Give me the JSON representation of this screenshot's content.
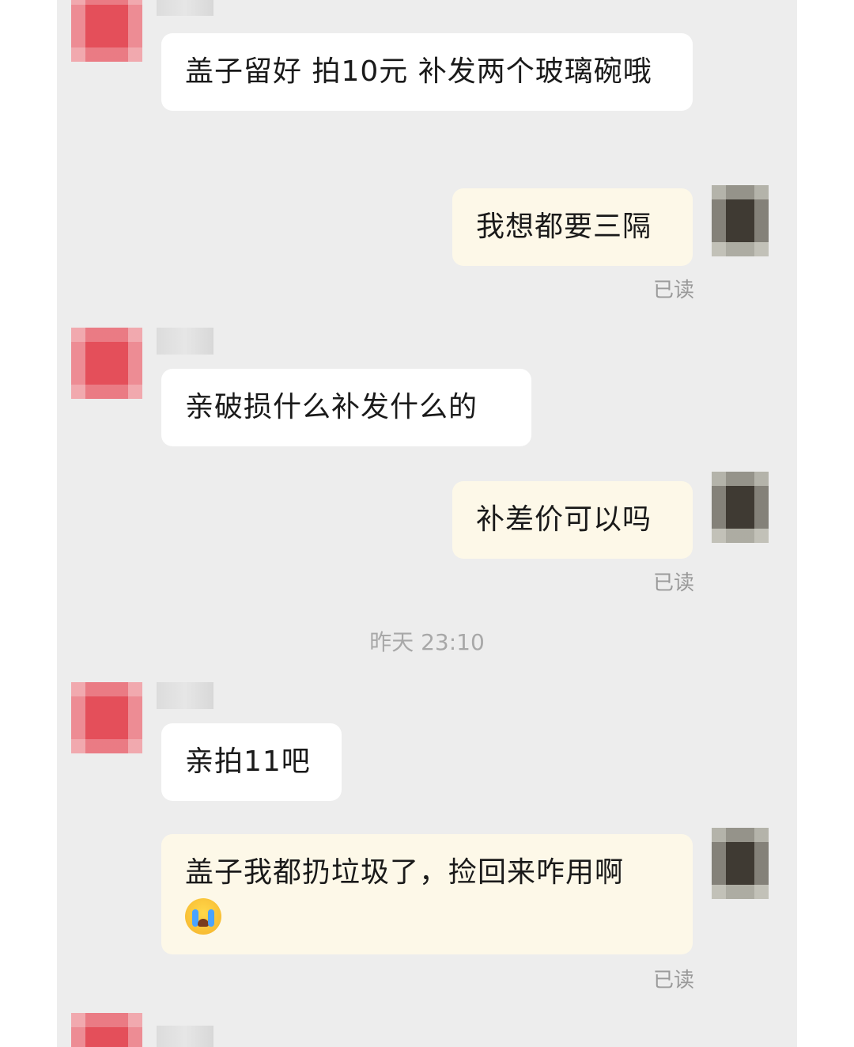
{
  "messages": [
    {
      "sender": "merchant",
      "text": "盖子留好 拍10元 补发两个玻璃碗哦"
    },
    {
      "sender": "user",
      "text": "我想都要三隔",
      "status": "已读"
    },
    {
      "sender": "merchant",
      "text": "亲破损什么补发什么的"
    },
    {
      "sender": "user",
      "text": "补差价可以吗",
      "status": "已读"
    },
    {
      "timestamp": "昨天 23:10"
    },
    {
      "sender": "merchant",
      "text": "亲拍11吧"
    },
    {
      "sender": "user",
      "text": "盖子我都扔垃圾了，捡回来咋用啊",
      "emoji": "crying-face",
      "status": "已读"
    }
  ]
}
